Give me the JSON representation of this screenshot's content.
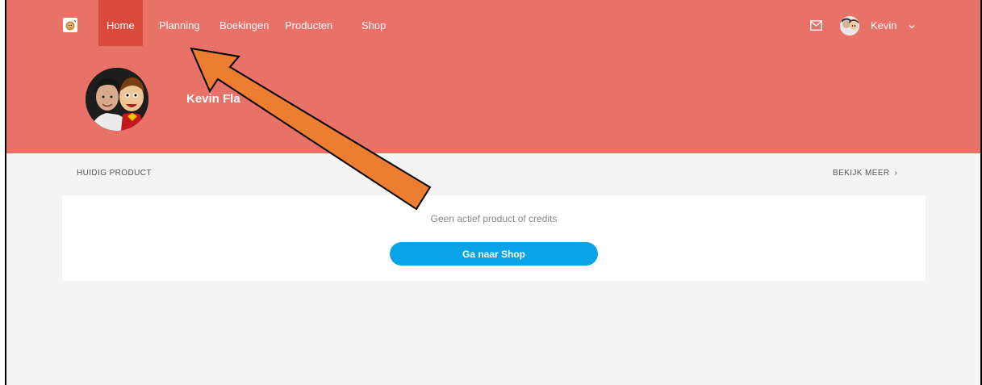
{
  "nav": {
    "items": [
      {
        "label": "Home",
        "active": true
      },
      {
        "label": "Planning"
      },
      {
        "label": "Boekingen"
      },
      {
        "label": "Producten"
      },
      {
        "label": "Shop"
      }
    ],
    "mail_icon": "mail-icon",
    "user_name": "Kevin",
    "user_menu_icon": "chevron-down-icon"
  },
  "profile": {
    "name": "Kevin Fla"
  },
  "current_product": {
    "section_label": "HUIDIG PRODUCT",
    "more_link": "BEKIJK MEER",
    "more_icon": "chevron-right-icon",
    "empty_message": "Geen actief product of credits",
    "shop_button": "Ga naar Shop"
  },
  "annotation": {
    "arrow_color": "#ed7d31",
    "points_to": "Planning"
  },
  "colors": {
    "header": "#e87168",
    "active_nav": "#d94a3a",
    "primary_button": "#0aa4e6",
    "page_background": "#f4f4f4"
  }
}
